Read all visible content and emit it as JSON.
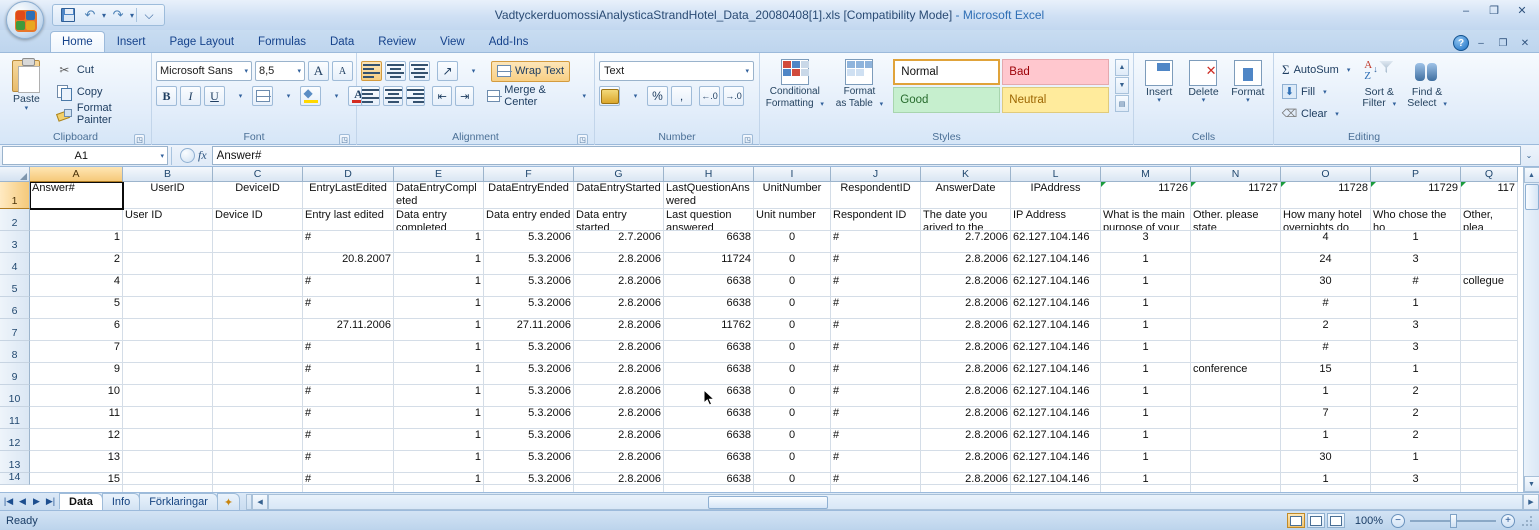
{
  "window": {
    "title_file": "VadtyckerduomossiAnalysticaStrandHotel_Data_20080408[1].xls",
    "title_mode": "[Compatibility Mode]",
    "title_app": "- Microsoft Excel",
    "minimize": "–",
    "maximize": "❐",
    "close": "✕"
  },
  "qat": {
    "save": "save-icon",
    "undo": "↶",
    "redo": "↷",
    "customize": "⌵"
  },
  "ribbon_tabs": [
    {
      "label": "Home",
      "active": true
    },
    {
      "label": "Insert",
      "active": false
    },
    {
      "label": "Page Layout",
      "active": false
    },
    {
      "label": "Formulas",
      "active": false
    },
    {
      "label": "Data",
      "active": false
    },
    {
      "label": "Review",
      "active": false
    },
    {
      "label": "View",
      "active": false
    },
    {
      "label": "Add-Ins",
      "active": false
    }
  ],
  "help": {
    "glyph": "?",
    "minimize": "–",
    "restore": "❐",
    "close": "✕"
  },
  "groups": {
    "clipboard": {
      "label": "Clipboard",
      "paste": "Paste",
      "cut": "Cut",
      "copy": "Copy",
      "format_painter": "Format Painter"
    },
    "font": {
      "label": "Font",
      "font_name": "Microsoft Sans",
      "font_size": "8,5",
      "grow": "A",
      "shrink": "A",
      "bold": "B",
      "italic": "I",
      "underline": "U",
      "font_color_letter": "A"
    },
    "alignment": {
      "label": "Alignment",
      "wrap_text": "Wrap Text",
      "merge_center": "Merge & Center"
    },
    "number": {
      "label": "Number",
      "format": "Text",
      "percent": "%",
      "comma": ",",
      "inc_dec": ".00",
      "dec_dec": ".00"
    },
    "styles": {
      "label": "Styles",
      "conditional_formatting": "Conditional\nFormatting",
      "conditional_formatting_l1": "Conditional",
      "conditional_formatting_l2": "Formatting",
      "format_as_table_l1": "Format",
      "format_as_table_l2": "as Table",
      "cells": [
        "Normal",
        "Bad",
        "Good",
        "Neutral"
      ]
    },
    "cells": {
      "label": "Cells",
      "insert": "Insert",
      "delete": "Delete",
      "format": "Format"
    },
    "editing": {
      "label": "Editing",
      "autosum": "AutoSum",
      "fill": "Fill",
      "clear": "Clear",
      "sort_filter_l1": "Sort &",
      "sort_filter_l2": "Filter",
      "find_select_l1": "Find &",
      "find_select_l2": "Select"
    }
  },
  "formula_bar": {
    "name_box": "A1",
    "fx": "fx",
    "content": "Answer#"
  },
  "grid": {
    "columns": [
      {
        "letter": "A",
        "width": 93,
        "selected": true
      },
      {
        "letter": "B",
        "width": 90,
        "selected": false
      },
      {
        "letter": "C",
        "width": 90,
        "selected": false
      },
      {
        "letter": "D",
        "width": 91,
        "selected": false
      },
      {
        "letter": "E",
        "width": 90,
        "selected": false
      },
      {
        "letter": "F",
        "width": 90,
        "selected": false
      },
      {
        "letter": "G",
        "width": 90,
        "selected": false
      },
      {
        "letter": "H",
        "width": 90,
        "selected": false
      },
      {
        "letter": "I",
        "width": 77,
        "selected": false
      },
      {
        "letter": "J",
        "width": 90,
        "selected": false
      },
      {
        "letter": "K",
        "width": 90,
        "selected": false
      },
      {
        "letter": "L",
        "width": 90,
        "selected": false
      },
      {
        "letter": "M",
        "width": 90,
        "selected": false
      },
      {
        "letter": "N",
        "width": 90,
        "selected": false
      },
      {
        "letter": "O",
        "width": 90,
        "selected": false
      },
      {
        "letter": "P",
        "width": 90,
        "selected": false
      },
      {
        "letter": "Q",
        "width": 57,
        "selected": false
      }
    ],
    "row_numbers": [
      1,
      2,
      3,
      4,
      5,
      6,
      7,
      8,
      9,
      10,
      11,
      12,
      13,
      14
    ],
    "header_row": {
      "values": [
        "Answer#",
        "UserID",
        "DeviceID",
        "EntryLastEdited",
        "DataEntryComplet",
        "DataEntryEnded",
        "DataEntryStarted",
        "LastQuestionAns",
        "UnitNumber",
        "RespondentID",
        "AnswerDate",
        "IPAddress",
        "11726",
        "11727",
        "11728",
        "11729",
        "117"
      ],
      "values_line2": [
        "",
        "",
        "",
        "",
        "ed",
        "",
        "",
        "wered",
        "",
        "",
        "",
        "",
        "",
        "",
        "",
        "",
        ""
      ],
      "error_triangle_cols": [
        12,
        13,
        14,
        15,
        16
      ]
    },
    "description_row": {
      "values": [
        "",
        "User ID",
        "Device ID",
        "Entry last edited",
        "Data entry",
        "Data entry ended",
        "Data entry started",
        "Last question",
        "Unit number",
        "Respondent ID",
        "The date you",
        "IP Address",
        "What is the main",
        "Other. please",
        "How many hotel",
        "Who chose the ho",
        "Other, plea"
      ],
      "values_line2": [
        "",
        "",
        "",
        "",
        "completed",
        "",
        "",
        "answered",
        "",
        "",
        "arived to the hotel",
        "",
        "purpose of your",
        "state",
        "overnights do you",
        "",
        ""
      ]
    },
    "data_rows": [
      {
        "row": 3,
        "cells": [
          "1",
          "",
          "",
          "#",
          "1",
          "5.3.2006",
          "2.7.2006",
          "6638",
          "0",
          "#",
          "2.7.2006",
          "62.127.104.146",
          "3",
          "",
          "4",
          "1",
          ""
        ]
      },
      {
        "row": 4,
        "cells": [
          "2",
          "",
          "",
          "20.8.2007",
          "1",
          "5.3.2006",
          "2.8.2006",
          "11724",
          "0",
          "#",
          "2.8.2006",
          "62.127.104.146",
          "1",
          "",
          "24",
          "3",
          ""
        ]
      },
      {
        "row": 5,
        "cells": [
          "4",
          "",
          "",
          "#",
          "1",
          "5.3.2006",
          "2.8.2006",
          "6638",
          "0",
          "#",
          "2.8.2006",
          "62.127.104.146",
          "1",
          "",
          "30",
          "#",
          "collegue"
        ]
      },
      {
        "row": 6,
        "cells": [
          "5",
          "",
          "",
          "#",
          "1",
          "5.3.2006",
          "2.8.2006",
          "6638",
          "0",
          "#",
          "2.8.2006",
          "62.127.104.146",
          "1",
          "",
          "#",
          "1",
          ""
        ]
      },
      {
        "row": 7,
        "cells": [
          "6",
          "",
          "",
          "27.11.2006",
          "1",
          "27.11.2006",
          "2.8.2006",
          "11762",
          "0",
          "#",
          "2.8.2006",
          "62.127.104.146",
          "1",
          "",
          "2",
          "3",
          ""
        ]
      },
      {
        "row": 8,
        "cells": [
          "7",
          "",
          "",
          "#",
          "1",
          "5.3.2006",
          "2.8.2006",
          "6638",
          "0",
          "#",
          "2.8.2006",
          "62.127.104.146",
          "1",
          "",
          "#",
          "3",
          ""
        ]
      },
      {
        "row": 9,
        "cells": [
          "9",
          "",
          "",
          "#",
          "1",
          "5.3.2006",
          "2.8.2006",
          "6638",
          "0",
          "#",
          "2.8.2006",
          "62.127.104.146",
          "1",
          "conference",
          "15",
          "1",
          ""
        ]
      },
      {
        "row": 10,
        "cells": [
          "10",
          "",
          "",
          "#",
          "1",
          "5.3.2006",
          "2.8.2006",
          "6638",
          "0",
          "#",
          "2.8.2006",
          "62.127.104.146",
          "1",
          "",
          "1",
          "2",
          ""
        ]
      },
      {
        "row": 11,
        "cells": [
          "11",
          "",
          "",
          "#",
          "1",
          "5.3.2006",
          "2.8.2006",
          "6638",
          "0",
          "#",
          "2.8.2006",
          "62.127.104.146",
          "1",
          "",
          "7",
          "2",
          ""
        ]
      },
      {
        "row": 12,
        "cells": [
          "12",
          "",
          "",
          "#",
          "1",
          "5.3.2006",
          "2.8.2006",
          "6638",
          "0",
          "#",
          "2.8.2006",
          "62.127.104.146",
          "1",
          "",
          "1",
          "2",
          ""
        ]
      },
      {
        "row": 13,
        "cells": [
          "13",
          "",
          "",
          "#",
          "1",
          "5.3.2006",
          "2.8.2006",
          "6638",
          "0",
          "#",
          "2.8.2006",
          "62.127.104.146",
          "1",
          "",
          "30",
          "1",
          ""
        ]
      },
      {
        "row": 14,
        "cells": [
          "15",
          "",
          "",
          "#",
          "1",
          "5.3.2006",
          "2.8.2006",
          "6638",
          "0",
          "#",
          "2.8.2006",
          "62.127.104.146",
          "1",
          "",
          "1",
          "3",
          ""
        ]
      }
    ]
  },
  "sheets": {
    "first": "◀│",
    "prev": "◀",
    "next": "▶",
    "last": "│▶",
    "tabs": [
      {
        "label": "Data",
        "active": true
      },
      {
        "label": "Info",
        "active": false
      },
      {
        "label": "Förklaringar",
        "active": false
      }
    ],
    "new_sheet_icon": "new-sheet-icon"
  },
  "status": {
    "text": "Ready",
    "zoom": "100%",
    "zoom_out": "−",
    "zoom_in": "+",
    "views": [
      "normal-view-icon",
      "page-layout-view-icon",
      "page-break-view-icon"
    ]
  },
  "colors": {
    "accent_orange": "#f5c97a",
    "error_triangle_green": "#1a9c3c",
    "good_green": "#c6efce",
    "bad_red": "#ffc7ce",
    "neutral_yellow": "#ffeb9c"
  }
}
